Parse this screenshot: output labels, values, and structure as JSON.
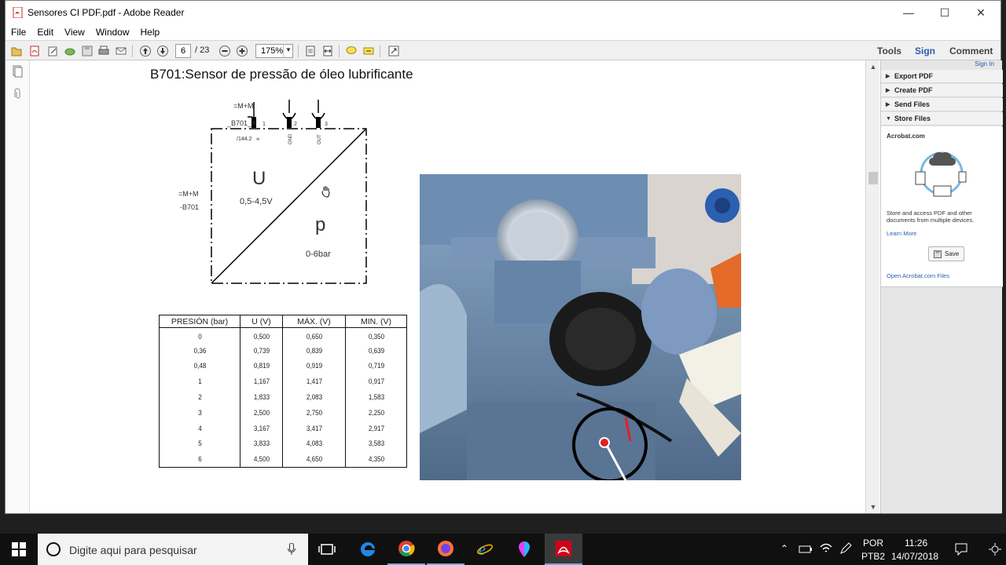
{
  "window": {
    "title": "Sensores CI PDF.pdf - Adobe Reader",
    "minimize": "—",
    "maximize": "☐",
    "close": "✕"
  },
  "menu": [
    "File",
    "Edit",
    "View",
    "Window",
    "Help"
  ],
  "toolbar": {
    "current_page": "6",
    "page_total": "/ 23",
    "zoom": "175%",
    "tools_label": "Tools",
    "sign_label": "Sign",
    "comment_label": "Comment"
  },
  "document": {
    "title": "B701:Sensor de pressão de óleo lubrificante",
    "diagram": {
      "label_mm_top": "=M+M",
      "label_b701x": "_B701_X",
      "label_mm_left": "=M+M",
      "label_b701": "-B701",
      "pin1": "1",
      "pin2": "2",
      "pin3": "3",
      "pin_ref": "/144.2",
      "pin1_sym": "±",
      "pin2_name": "GND",
      "pin3_name": "OUT",
      "u_symbol": "U",
      "u_range": "0,5-4,5V",
      "p_symbol": "p",
      "p_range": "0-6bar"
    },
    "table": {
      "headers": [
        "PRESIÓN (bar)",
        "U (V)",
        "MÁX. (V)",
        "MIN. (V)"
      ],
      "rows": [
        [
          "0",
          "0,500",
          "0,650",
          "0,350"
        ],
        [
          "0,36",
          "0,739",
          "0,839",
          "0,639"
        ],
        [
          "0,48",
          "0,819",
          "0,919",
          "0,719"
        ],
        [
          "1",
          "1,167",
          "1,417",
          "0,917"
        ],
        [
          "2",
          "1,833",
          "2,083",
          "1,583"
        ],
        [
          "3",
          "2,500",
          "2,750",
          "2,250"
        ],
        [
          "4",
          "3,167",
          "3,417",
          "2,917"
        ],
        [
          "5",
          "3,833",
          "4,083",
          "3,583"
        ],
        [
          "6",
          "4,500",
          "4,650",
          "4,350"
        ]
      ]
    }
  },
  "right_panel": {
    "sign_in": "Sign In",
    "items": [
      "Export PDF",
      "Create PDF",
      "Send Files",
      "Store Files"
    ],
    "acrobat_com": "Acrobat.com",
    "description": "Store and access PDF and other documents from multiple devices.",
    "learn_more": "Learn More",
    "save_label": "Save",
    "open_files": "Open Acrobat.com Files"
  },
  "taskbar": {
    "search_placeholder": "Digite aqui para pesquisar",
    "lang_top": "POR",
    "lang_bottom": "PTB2",
    "time": "11:26",
    "date": "14/07/2018"
  },
  "colors": {
    "pdf_red": "#d0021b",
    "link_blue": "#2a5db0",
    "engine_blue": "#6f8fb3"
  }
}
